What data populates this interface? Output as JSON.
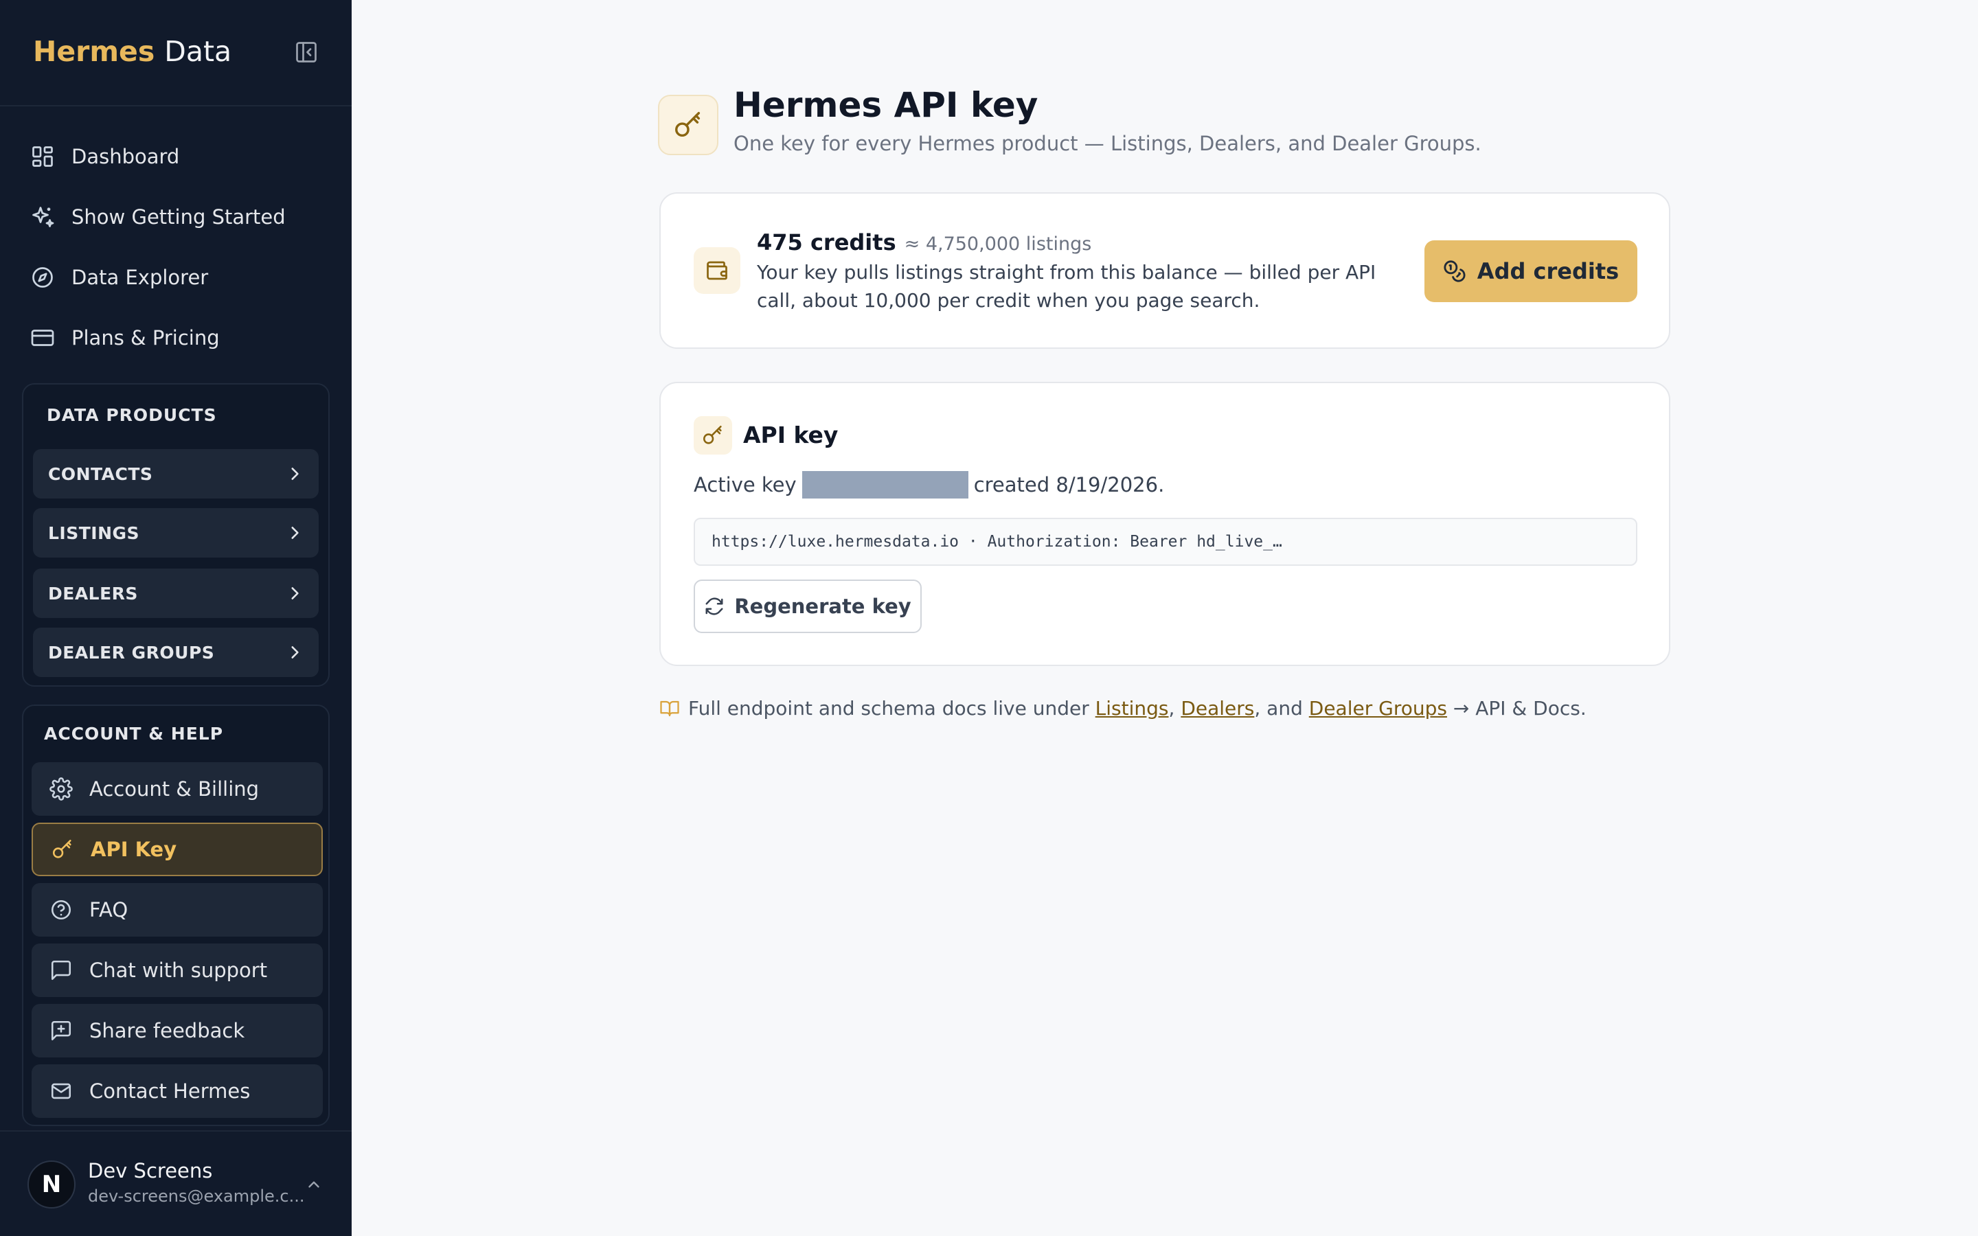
{
  "sidebar": {
    "brand": {
      "primary": "Hermes",
      "secondary": "Data"
    },
    "nav": [
      {
        "label": "Dashboard",
        "icon": "dashboard-icon"
      },
      {
        "label": "Show Getting Started",
        "icon": "sparkles-icon"
      },
      {
        "label": "Data Explorer",
        "icon": "compass-icon"
      },
      {
        "label": "Plans & Pricing",
        "icon": "credit-card-icon"
      }
    ],
    "data_products": {
      "title": "DATA PRODUCTS",
      "items": [
        {
          "label": "CONTACTS"
        },
        {
          "label": "LISTINGS"
        },
        {
          "label": "DEALERS"
        },
        {
          "label": "DEALER GROUPS"
        }
      ]
    },
    "account_help": {
      "title": "ACCOUNT & HELP",
      "items": [
        {
          "label": "Account & Billing",
          "icon": "gear-icon"
        },
        {
          "label": "API Key",
          "icon": "key-icon",
          "active": true
        },
        {
          "label": "FAQ",
          "icon": "help-circle-icon"
        },
        {
          "label": "Chat with support",
          "icon": "chat-icon"
        },
        {
          "label": "Share feedback",
          "icon": "feedback-icon"
        },
        {
          "label": "Contact Hermes",
          "icon": "mail-icon"
        }
      ]
    },
    "user": {
      "initial": "N",
      "name": "Dev Screens",
      "email": "dev-screens@example.c..."
    }
  },
  "header": {
    "title": "Hermes API key",
    "subtitle": "One key for every Hermes product — Listings, Dealers, and Dealer Groups."
  },
  "credits": {
    "amount": "475 credits",
    "approx": "≈ 4,750,000 listings",
    "description": "Your key pulls listings straight from this balance — billed per API call, about 10,000 per credit when you page search.",
    "button": "Add credits"
  },
  "api_key": {
    "title": "API key",
    "active_prefix": "Active key",
    "created": "created 8/19/2026.",
    "endpoint": "https://luxe.hermesdata.io · Authorization: Bearer hd_live_…",
    "regenerate": "Regenerate key"
  },
  "footnote": {
    "prefix": "Full endpoint and schema docs live under",
    "link1": "Listings",
    "sep1": ",",
    "link2": "Dealers",
    "sep2": ", and",
    "link3": "Dealer Groups",
    "suffix": "→ API & Docs."
  },
  "colors": {
    "accent": "#e6bd6a",
    "sidebar_bg": "#111a2b",
    "active_text": "#f2c15f"
  }
}
